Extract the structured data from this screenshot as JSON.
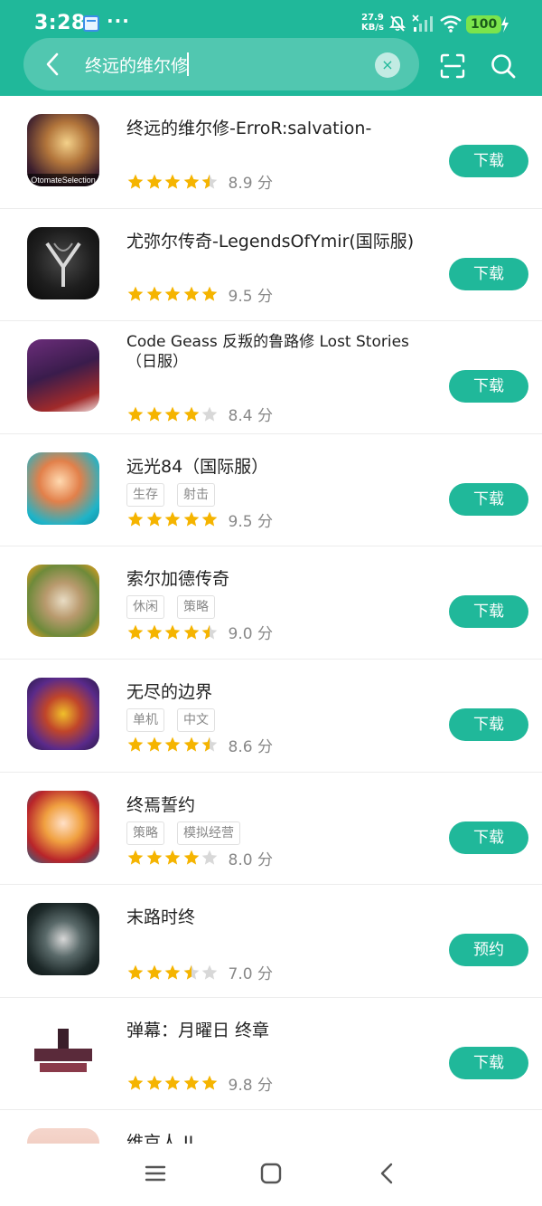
{
  "status": {
    "time": "3:28",
    "dots": "···",
    "speed_value": "27.9",
    "speed_unit": "KB/s",
    "battery": "100"
  },
  "search": {
    "query": "终远的维尔修",
    "clear_glyph": "×"
  },
  "colors": {
    "brand": "#20b89a",
    "star": "#f5b400",
    "star_empty": "#d8d8d8"
  },
  "results": [
    {
      "title": "终远的维尔修-ErroR:salvation-",
      "tags": [],
      "stars": 4.5,
      "score": "8.9 分",
      "button": "下载",
      "icon_label": "OtomateSelection"
    },
    {
      "title": "尤弥尔传奇-LegendsOfYmir(国际服)",
      "tags": [],
      "stars": 5,
      "score": "9.5 分",
      "button": "下载",
      "icon_label": ""
    },
    {
      "title": "Code Geass 反叛的鲁路修 Lost Stories（日服）",
      "tags": [],
      "stars": 4,
      "score": "8.4 分",
      "button": "下载",
      "icon_label": ""
    },
    {
      "title": "远光84（国际服）",
      "tags": [
        "生存",
        "射击"
      ],
      "stars": 5,
      "score": "9.5 分",
      "button": "下载",
      "icon_label": ""
    },
    {
      "title": "索尔加德传奇",
      "tags": [
        "休闲",
        "策略"
      ],
      "stars": 4.5,
      "score": "9.0 分",
      "button": "下载",
      "icon_label": ""
    },
    {
      "title": "无尽的边界",
      "tags": [
        "单机",
        "中文"
      ],
      "stars": 4.5,
      "score": "8.6 分",
      "button": "下载",
      "icon_label": ""
    },
    {
      "title": "终焉誓约",
      "tags": [
        "策略",
        "模拟经营"
      ],
      "stars": 4,
      "score": "8.0 分",
      "button": "下载",
      "icon_label": ""
    },
    {
      "title": "末路时终",
      "tags": [],
      "stars": 3.5,
      "score": "7.0 分",
      "button": "预约",
      "icon_label": ""
    },
    {
      "title": "弹幕：月曜日 终章",
      "tags": [],
      "stars": 5,
      "score": "9.8 分",
      "button": "下载",
      "icon_label": ""
    },
    {
      "title": "维京人 II",
      "tags": [],
      "stars": 0,
      "score": "",
      "button": "",
      "icon_label": ""
    }
  ],
  "icons": {
    "back": "chevron-left-icon",
    "clear": "close-icon",
    "scan": "scan-icon",
    "search": "search-icon",
    "nav_menu": "menu-icon",
    "nav_home": "square-icon",
    "nav_back": "triangle-back-icon"
  }
}
